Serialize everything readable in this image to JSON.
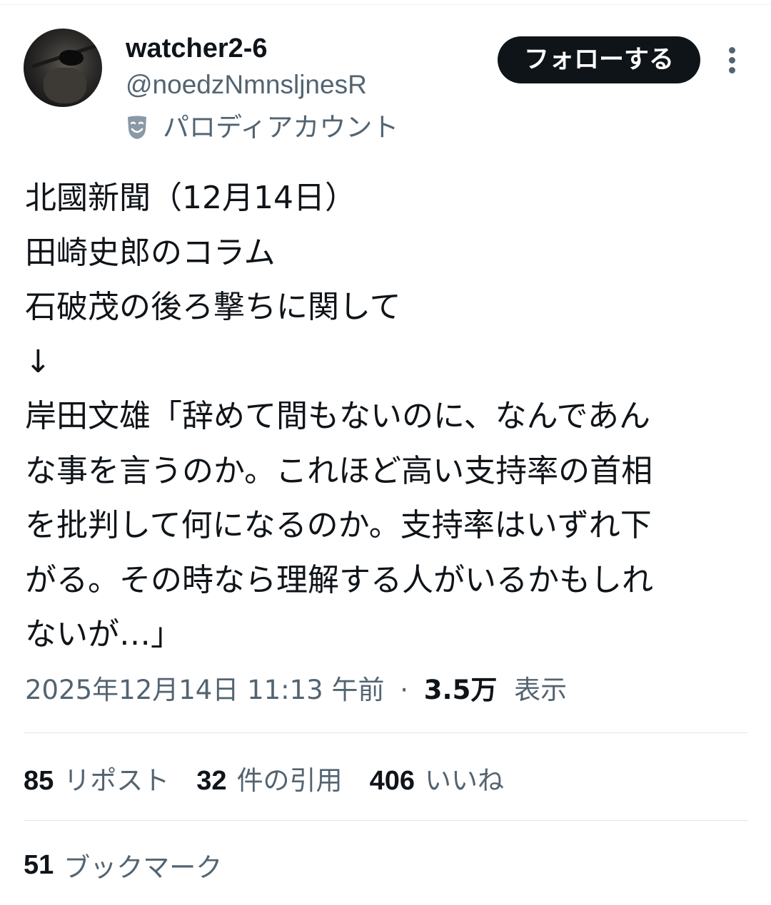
{
  "author": {
    "display_name": "watcher2-6",
    "handle": "@noedzNmnsljnesR",
    "account_label": "パロディアカウント",
    "avatar_icon": "avatar-photo-eyepatch-soldier",
    "label_icon": "theater-mask-icon"
  },
  "actions": {
    "follow_label": "フォローする",
    "more_icon": "more-options-vertical-icon"
  },
  "tweet": {
    "lines": [
      "北國新聞（12月14日）",
      "田崎史郎のコラム",
      "石破茂の後ろ撃ちに関して",
      "↓",
      "岸田文雄「辞めて間もないのに、なんであん",
      "な事を言うのか。これほど高い支持率の首相",
      "を批判して何になるのか。支持率はいずれ下",
      "がる。その時なら理解する人がいるかもしれ",
      "ないが…」"
    ],
    "timestamp": "2025年12月14日 11:13 午前",
    "separator": "·",
    "views_count": "3.5万",
    "views_label": "表示"
  },
  "stats": {
    "reposts": {
      "count": "85",
      "label": "リポスト"
    },
    "quotes": {
      "count": "32",
      "label": "件の引用"
    },
    "likes": {
      "count": "406",
      "label": "いいね"
    },
    "bookmarks": {
      "count": "51",
      "label": "ブックマーク"
    }
  },
  "colors": {
    "text_primary": "#0f1419",
    "text_secondary": "#536471",
    "button_bg": "#0f1419",
    "divider": "#e1e6e8"
  }
}
